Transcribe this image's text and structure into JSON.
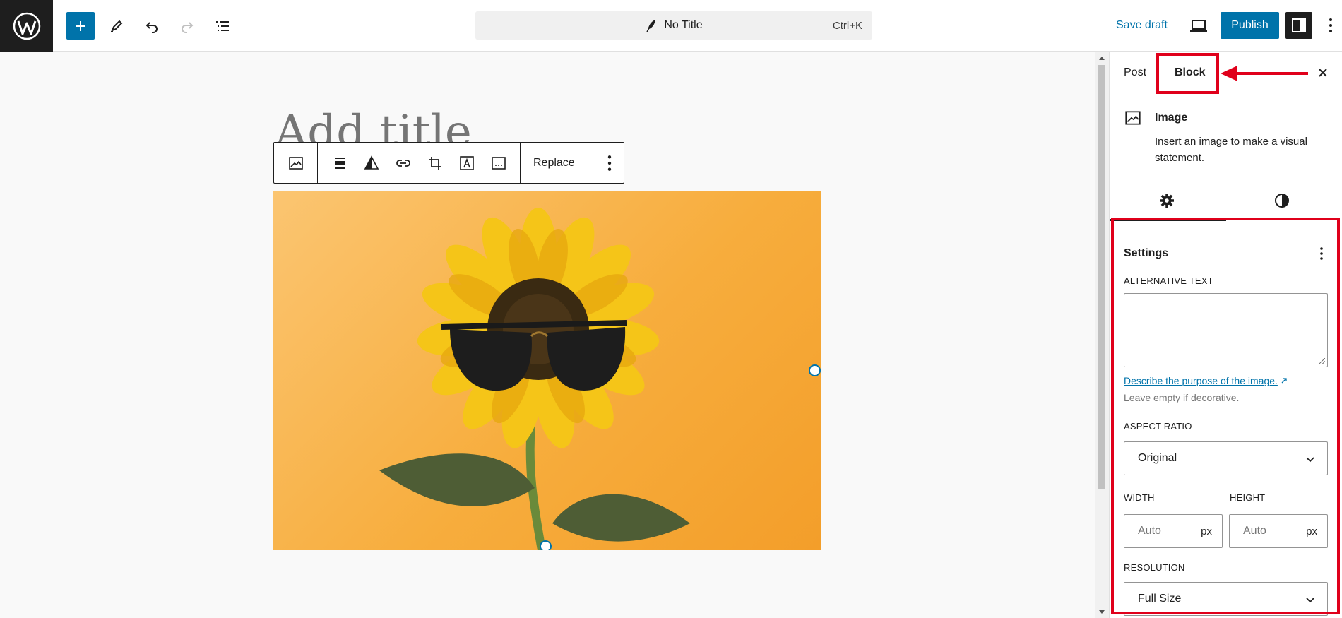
{
  "topbar": {
    "document_title": "No Title",
    "shortcut": "Ctrl+K",
    "save_draft": "Save draft",
    "publish": "Publish"
  },
  "editor": {
    "title_placeholder": "Add title",
    "toolbar": {
      "replace_label": "Replace"
    }
  },
  "sidebar": {
    "tabs": [
      {
        "label": "Post",
        "active": false
      },
      {
        "label": "Block",
        "active": true
      }
    ],
    "block": {
      "name": "Image",
      "description": "Insert an image to make a visual statement."
    },
    "settings": {
      "title": "Settings",
      "alt_text_label": "ALTERNATIVE TEXT",
      "alt_text_value": "",
      "alt_link": "Describe the purpose of the image.",
      "alt_help": "Leave empty if decorative.",
      "aspect_ratio_label": "ASPECT RATIO",
      "aspect_ratio_value": "Original",
      "width_label": "WIDTH",
      "width_placeholder": "Auto",
      "width_unit": "px",
      "height_label": "HEIGHT",
      "height_placeholder": "Auto",
      "height_unit": "px",
      "resolution_label": "RESOLUTION",
      "resolution_value": "Full Size"
    }
  },
  "colors": {
    "accent": "#0073aa",
    "annotation": "#e0001b",
    "image_background": "#f7ad3d"
  }
}
